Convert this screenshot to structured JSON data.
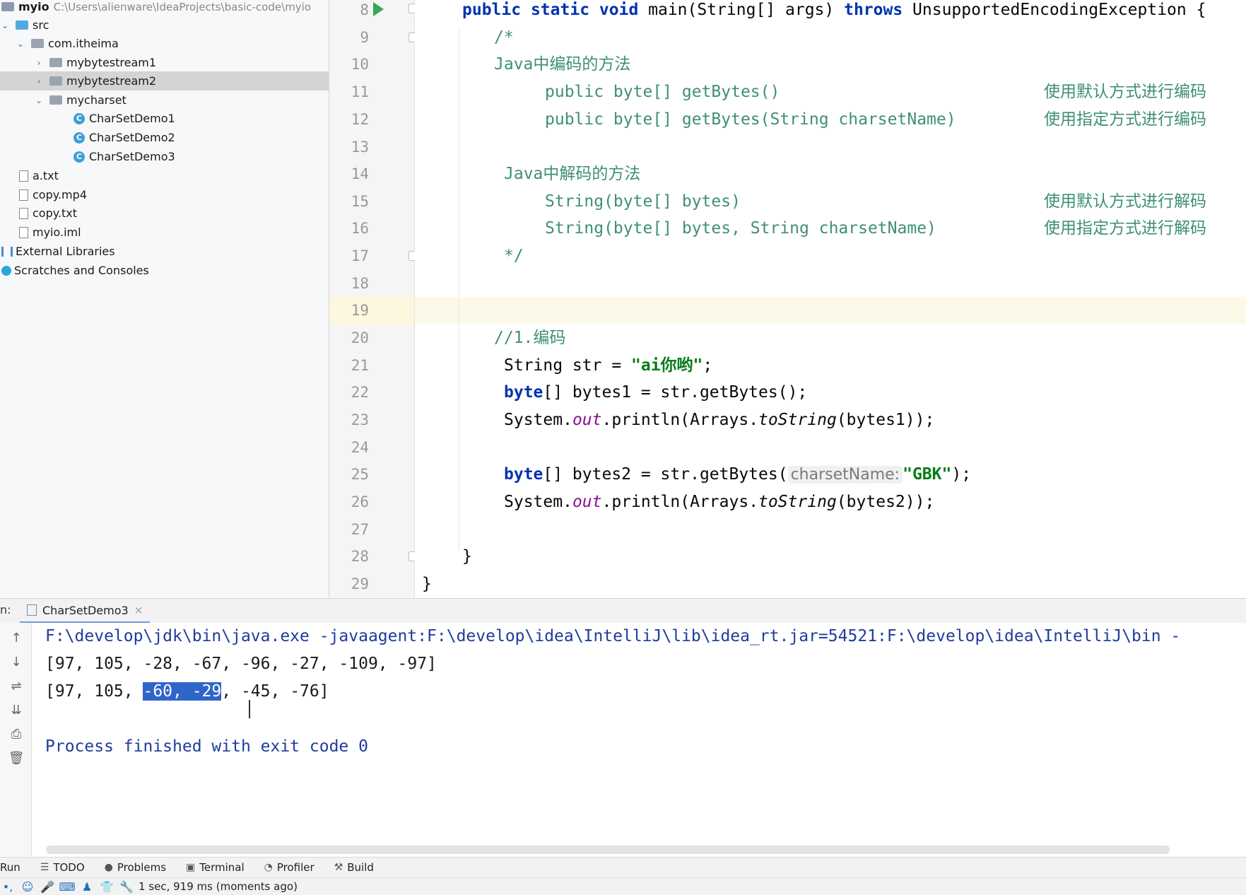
{
  "project": {
    "root_name": "myio",
    "root_path": "C:\\Users\\alienware\\IdeaProjects\\basic-code\\myio",
    "items": [
      {
        "label": "src"
      },
      {
        "label": "com.itheima"
      },
      {
        "label": "mybytestream1"
      },
      {
        "label": "mybytestream2"
      },
      {
        "label": "mycharset"
      },
      {
        "label": "CharSetDemo1"
      },
      {
        "label": "CharSetDemo2"
      },
      {
        "label": "CharSetDemo3"
      },
      {
        "label": "a.txt"
      },
      {
        "label": "copy.mp4"
      },
      {
        "label": "copy.txt"
      },
      {
        "label": "myio.iml"
      },
      {
        "label": "External Libraries"
      },
      {
        "label": "Scratches and Consoles"
      }
    ]
  },
  "editor": {
    "line_numbers": [
      "8",
      "9",
      "10",
      "11",
      "12",
      "13",
      "14",
      "15",
      "16",
      "17",
      "18",
      "19",
      "20",
      "21",
      "22",
      "23",
      "24",
      "25",
      "26",
      "27",
      "28",
      "29"
    ],
    "tokens": {
      "public": "public",
      "static": "static",
      "void": "void",
      "throws": "throws",
      "byte": "byte",
      "main_sig": " main(String[] args) ",
      "exception": " UnsupportedEncodingException {",
      "l9": "/*",
      "l10": "Java中编码的方法",
      "l11_code": "public byte[] getBytes()",
      "l11_desc": "使用默认方式进行编码",
      "l12_code": "public byte[] getBytes(String charsetName)",
      "l12_desc": "使用指定方式进行编码",
      "l14": "Java中解码的方法",
      "l15_code": "String(byte[] bytes)",
      "l15_desc": "使用默认方式进行解码",
      "l16_code": "String(byte[] bytes, String charsetName)",
      "l16_desc": "使用指定方式进行解码",
      "l17": "*/",
      "l20": "//1.编码",
      "l21_a": "String str = ",
      "l21_str": "\"ai你哟\"",
      "l21_end": ";",
      "l22_rest": "[] bytes1 = str.getBytes();",
      "sys": "System.",
      "out": "out",
      "println_open": ".println(Arrays.",
      "tostring": "toString",
      "l23_end": "(bytes1));",
      "l25_mid": "[] bytes2 = str.getBytes(",
      "hint": "charsetName:",
      "l25_str": "\"GBK\"",
      "l25_end": ");",
      "l26_end": "(bytes2));",
      "close_brace": "}"
    }
  },
  "run_panel": {
    "label": "n:",
    "tab_name": "CharSetDemo3",
    "close_glyph": "×",
    "console": {
      "command": "F:\\develop\\jdk\\bin\\java.exe -javaagent:F:\\develop\\idea\\IntelliJ\\lib\\idea_rt.jar=54521:F:\\develop\\idea\\IntelliJ\\bin -",
      "line1": "[97, 105, -28, -67, -96, -27, -109, -97]",
      "line2_pre": "[97, 105, ",
      "line2_sel": "-60, -29",
      "line2_post": ", -45, -76]",
      "finish": "Process finished with exit code 0"
    }
  },
  "tool_tabs": [
    {
      "label": "Run"
    },
    {
      "label": "TODO",
      "icon": "list-icon"
    },
    {
      "label": "Problems",
      "icon": "problems-icon"
    },
    {
      "label": "Terminal",
      "icon": "terminal-icon"
    },
    {
      "label": "Profiler",
      "icon": "profiler-icon"
    },
    {
      "label": "Build",
      "icon": "hammer-icon"
    }
  ],
  "status": {
    "message": "1 sec, 919 ms (moments ago)"
  },
  "colors": {
    "keyword": "#0033b3",
    "comment": "#3f8f76",
    "string": "#067d17",
    "selection": "#2f65ca",
    "current_line": "#fdf9e8"
  }
}
